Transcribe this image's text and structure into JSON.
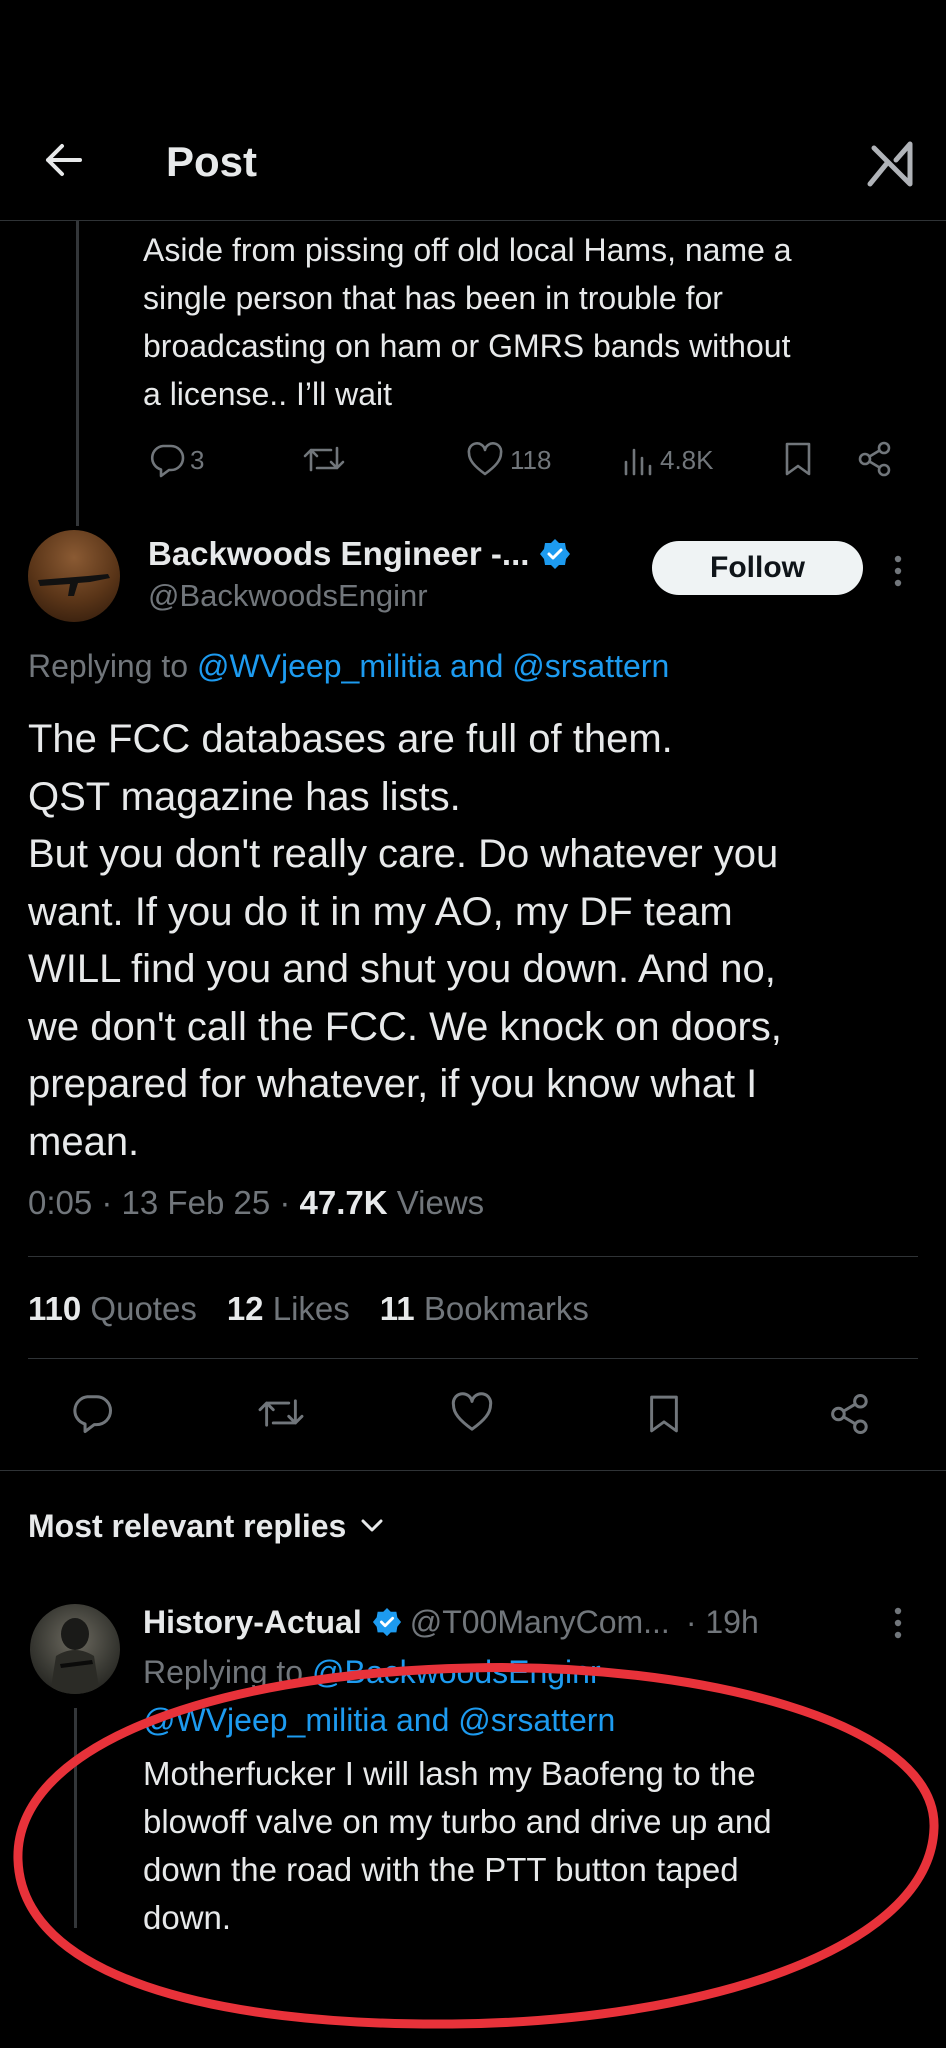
{
  "header": {
    "title": "Post"
  },
  "parent_post": {
    "text_lines": [
      "Aside from pissing off old local Hams, name a",
      "single person that has been in trouble for",
      "broadcasting on ham or GMRS bands without",
      "a license.. I’ll wait"
    ],
    "replies": "3",
    "likes": "118",
    "views": "4.8K"
  },
  "main_post": {
    "display_name": "Backwoods Engineer -...",
    "handle": "@BackwoodsEnginr",
    "follow_label": "Follow",
    "replying_prefix": "Replying to",
    "replying_to": "@WVjeep_militia and @srsattern",
    "body_lines": [
      "The FCC databases are full of them.",
      "QST magazine has lists.",
      "But you don't really care.  Do whatever you",
      "want.  If you do it in my AO, my DF team",
      "WILL find you and shut you down.  And no,",
      "we don't call the FCC.  We knock on doors,",
      "prepared for whatever, if you know what I",
      "mean."
    ],
    "time": "0:05 · 13 Feb 25 ·",
    "views_count": "47.7K",
    "views_label": "Views",
    "stats": [
      {
        "count": "110",
        "label": "Quotes"
      },
      {
        "count": "12",
        "label": "Likes"
      },
      {
        "count": "11",
        "label": "Bookmarks"
      }
    ]
  },
  "replies_section": {
    "label": "Most relevant replies"
  },
  "reply": {
    "display_name": "History-Actual",
    "handle": "@T00ManyCom...",
    "time": "· 19h",
    "replying_prefix": "Replying to",
    "replying_line1": "@BackwoodsEnginr",
    "replying_line2": "@WVjeep_militia and @srsattern",
    "body_lines": [
      "Motherfucker I will lash my Baofeng to the",
      "blowoff valve on my turbo and drive up and",
      "down the road with the PTT button taped",
      "down."
    ]
  },
  "colors": {
    "accent": "#1d9bf0",
    "annotation": "#e8323a",
    "muted": "#71767b"
  },
  "icons": [
    "back-arrow-icon",
    "grok-icon",
    "reply-icon",
    "retweet-icon",
    "like-icon",
    "views-icon",
    "bookmark-icon",
    "share-icon",
    "verified-icon",
    "more-icon",
    "chevron-down-icon"
  ]
}
